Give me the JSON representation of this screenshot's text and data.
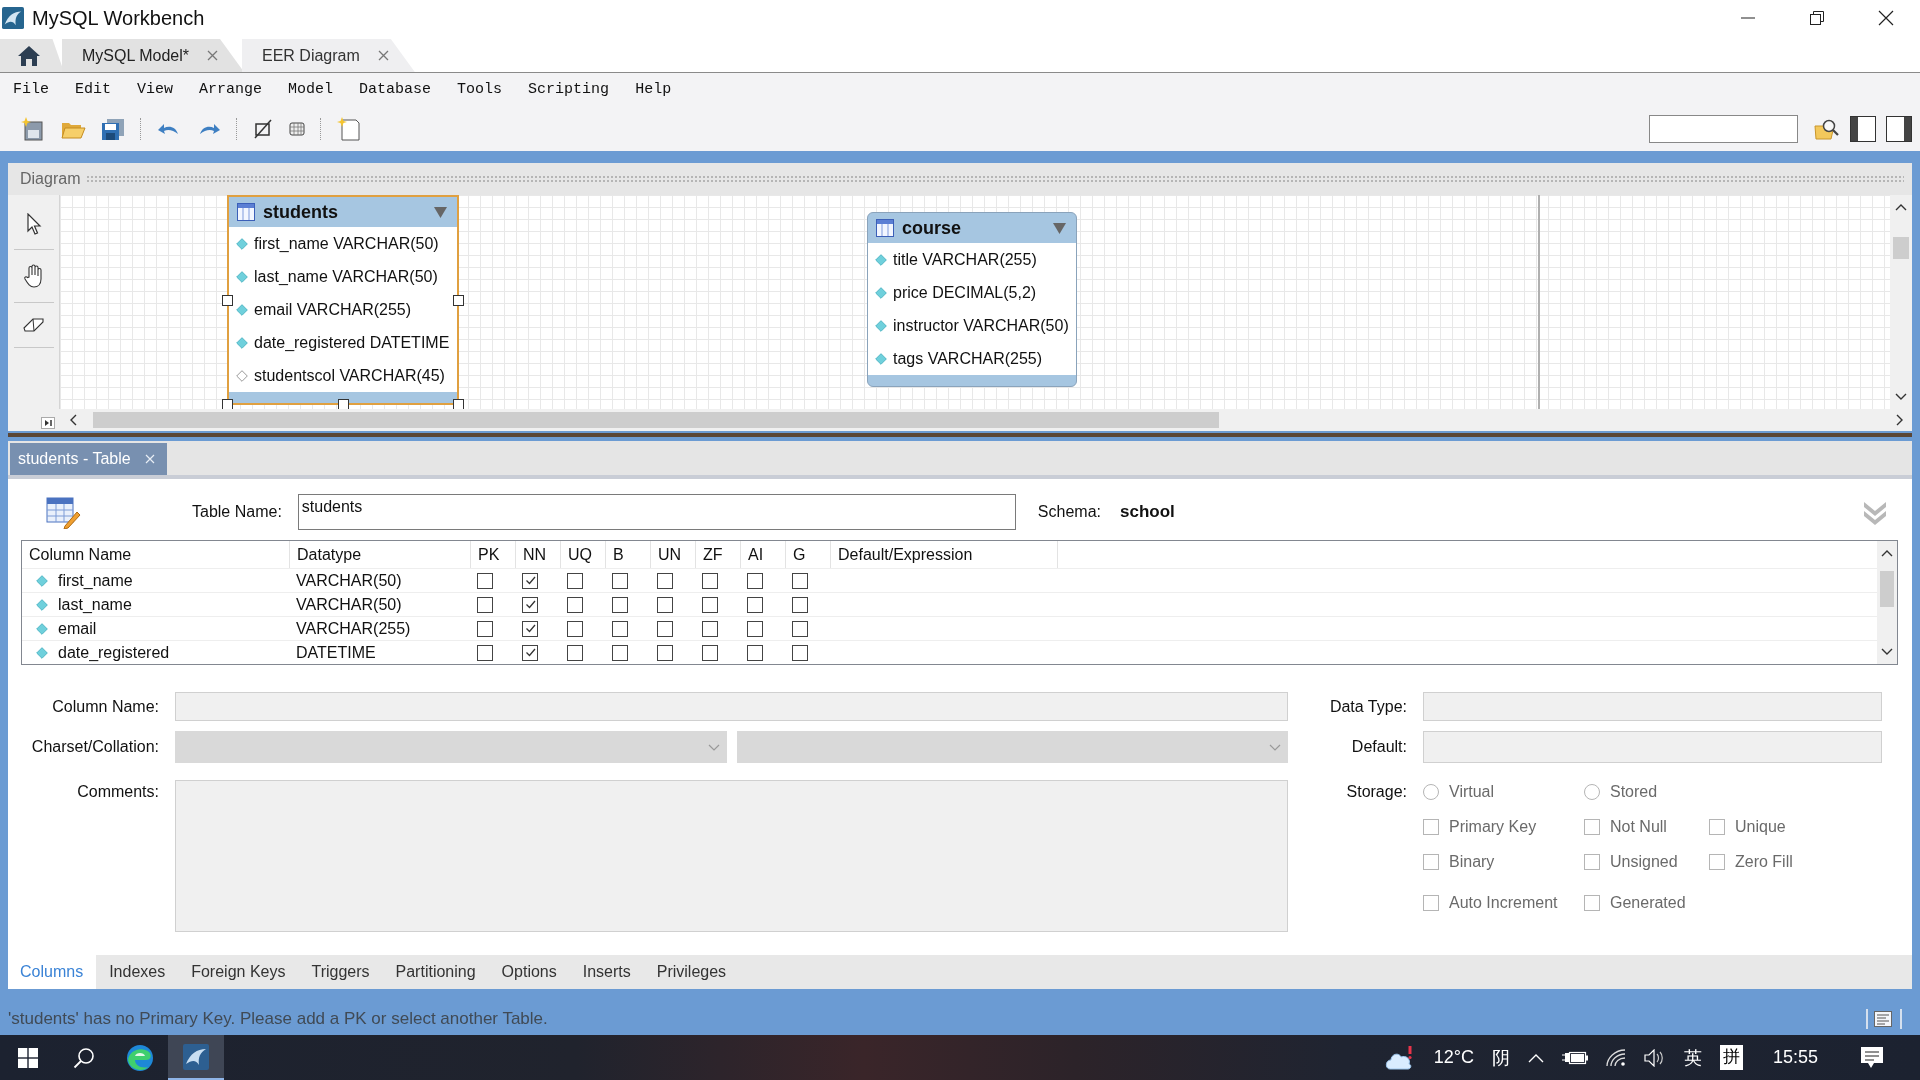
{
  "window": {
    "title": "MySQL Workbench"
  },
  "tabs": [
    {
      "label": "MySQL Model*",
      "selected": false
    },
    {
      "label": "EER Diagram",
      "selected": true
    }
  ],
  "menu": [
    "File",
    "Edit",
    "View",
    "Arrange",
    "Model",
    "Database",
    "Tools",
    "Scripting",
    "Help"
  ],
  "diagram": {
    "title": "Diagram",
    "tables": [
      {
        "name": "students",
        "selected": true,
        "columns": [
          {
            "text": "first_name VARCHAR(50)",
            "not_null": true
          },
          {
            "text": "last_name VARCHAR(50)",
            "not_null": true
          },
          {
            "text": "email VARCHAR(255)",
            "not_null": true
          },
          {
            "text": "date_registered DATETIME",
            "not_null": true
          },
          {
            "text": "studentscol VARCHAR(45)",
            "not_null": false
          }
        ]
      },
      {
        "name": "course",
        "selected": false,
        "columns": [
          {
            "text": "title VARCHAR(255)",
            "not_null": true
          },
          {
            "text": "price DECIMAL(5,2)",
            "not_null": true
          },
          {
            "text": "instructor VARCHAR(50)",
            "not_null": true
          },
          {
            "text": "tags VARCHAR(255)",
            "not_null": true
          }
        ]
      }
    ]
  },
  "editor": {
    "tab": "students - Table",
    "table_name_label": "Table Name:",
    "table_name": "students",
    "schema_label": "Schema:",
    "schema": "school",
    "grid": {
      "columns": [
        "Column Name",
        "Datatype",
        "PK",
        "NN",
        "UQ",
        "B",
        "UN",
        "ZF",
        "AI",
        "G",
        "Default/Expression"
      ],
      "rows": [
        {
          "name": "first_name",
          "type": "VARCHAR(50)",
          "flags": [
            {
              "checked": false
            },
            {
              "checked": true
            },
            {
              "checked": false
            },
            {
              "checked": false
            },
            {
              "checked": false
            },
            {
              "checked": false
            },
            {
              "checked": false
            },
            {
              "checked": false
            }
          ]
        },
        {
          "name": "last_name",
          "type": "VARCHAR(50)",
          "flags": [
            {
              "checked": false
            },
            {
              "checked": true
            },
            {
              "checked": false
            },
            {
              "checked": false
            },
            {
              "checked": false
            },
            {
              "checked": false
            },
            {
              "checked": false
            },
            {
              "checked": false
            }
          ]
        },
        {
          "name": "email",
          "type": "VARCHAR(255)",
          "flags": [
            {
              "checked": false
            },
            {
              "checked": true
            },
            {
              "checked": false
            },
            {
              "checked": false
            },
            {
              "checked": false
            },
            {
              "checked": false
            },
            {
              "checked": false
            },
            {
              "checked": false
            }
          ]
        },
        {
          "name": "date_registered",
          "type": "DATETIME",
          "flags": [
            {
              "checked": false
            },
            {
              "checked": true
            },
            {
              "checked": false
            },
            {
              "checked": false
            },
            {
              "checked": false
            },
            {
              "checked": false
            },
            {
              "checked": false
            },
            {
              "checked": false
            }
          ]
        }
      ]
    },
    "details": {
      "disabled": true,
      "column_name_label": "Column Name:",
      "charset_label": "Charset/Collation:",
      "comments_label": "Comments:",
      "data_type_label": "Data Type:",
      "default_label": "Default:",
      "storage_label": "Storage:",
      "storage": [
        {
          "label": "Virtual",
          "selected": false
        },
        {
          "label": "Stored",
          "selected": false
        }
      ],
      "options": [
        {
          "label": "Primary Key",
          "checked": false
        },
        {
          "label": "Not Null",
          "checked": false
        },
        {
          "label": "Unique",
          "checked": false
        },
        {
          "label": "Binary",
          "checked": false
        },
        {
          "label": "Unsigned",
          "checked": false
        },
        {
          "label": "Zero Fill",
          "checked": false
        },
        {
          "label": "Auto Increment",
          "checked": false
        },
        {
          "label": "Generated",
          "checked": false
        }
      ]
    },
    "tabs": [
      {
        "label": "Columns",
        "selected": true
      },
      {
        "label": "Indexes",
        "selected": false
      },
      {
        "label": "Foreign Keys",
        "selected": false
      },
      {
        "label": "Triggers",
        "selected": false
      },
      {
        "label": "Partitioning",
        "selected": false
      },
      {
        "label": "Options",
        "selected": false
      },
      {
        "label": "Inserts",
        "selected": false
      },
      {
        "label": "Privileges",
        "selected": false
      }
    ]
  },
  "status_bar": {
    "message": "'students' has no Primary Key. Please add a PK or select another Table."
  },
  "taskbar": {
    "temperature": "12°C",
    "weather": "阴",
    "input_language": "英",
    "input_mode": "拼",
    "clock": "15:55"
  }
}
